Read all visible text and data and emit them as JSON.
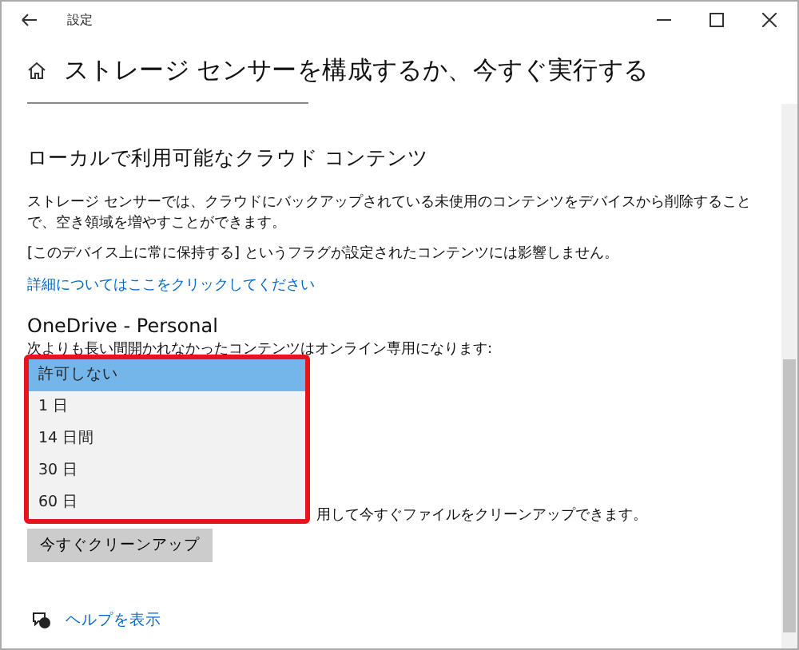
{
  "window": {
    "title": "設定"
  },
  "page": {
    "title": "ストレージ センサーを構成するか、今すぐ実行する"
  },
  "section": {
    "heading": "ローカルで利用可能なクラウド コンテンツ",
    "description": "ストレージ センサーでは、クラウドにバックアップされている未使用のコンテンツをデバイスから削除することで、空き領域を増やすことができます。",
    "note": "[このデバイス上に常に保持する] というフラグが設定されたコンテンツには影響しません。",
    "link": "詳細についてはここをクリックしてください"
  },
  "onedrive": {
    "name": "OneDrive - Personal",
    "caption": "次よりも長い間開かれなかったコンテンツはオンライン専用になります:",
    "options": [
      {
        "label": "許可しない",
        "selected": true
      },
      {
        "label": "1 日",
        "selected": false
      },
      {
        "label": "14 日間",
        "selected": false
      },
      {
        "label": "30 日",
        "selected": false
      },
      {
        "label": "60 日",
        "selected": false
      }
    ]
  },
  "cleanup": {
    "text": "用して今すぐファイルをクリーンアップできます。",
    "button": "今すぐクリーンアップ"
  },
  "help": {
    "link": "ヘルプを表示"
  }
}
